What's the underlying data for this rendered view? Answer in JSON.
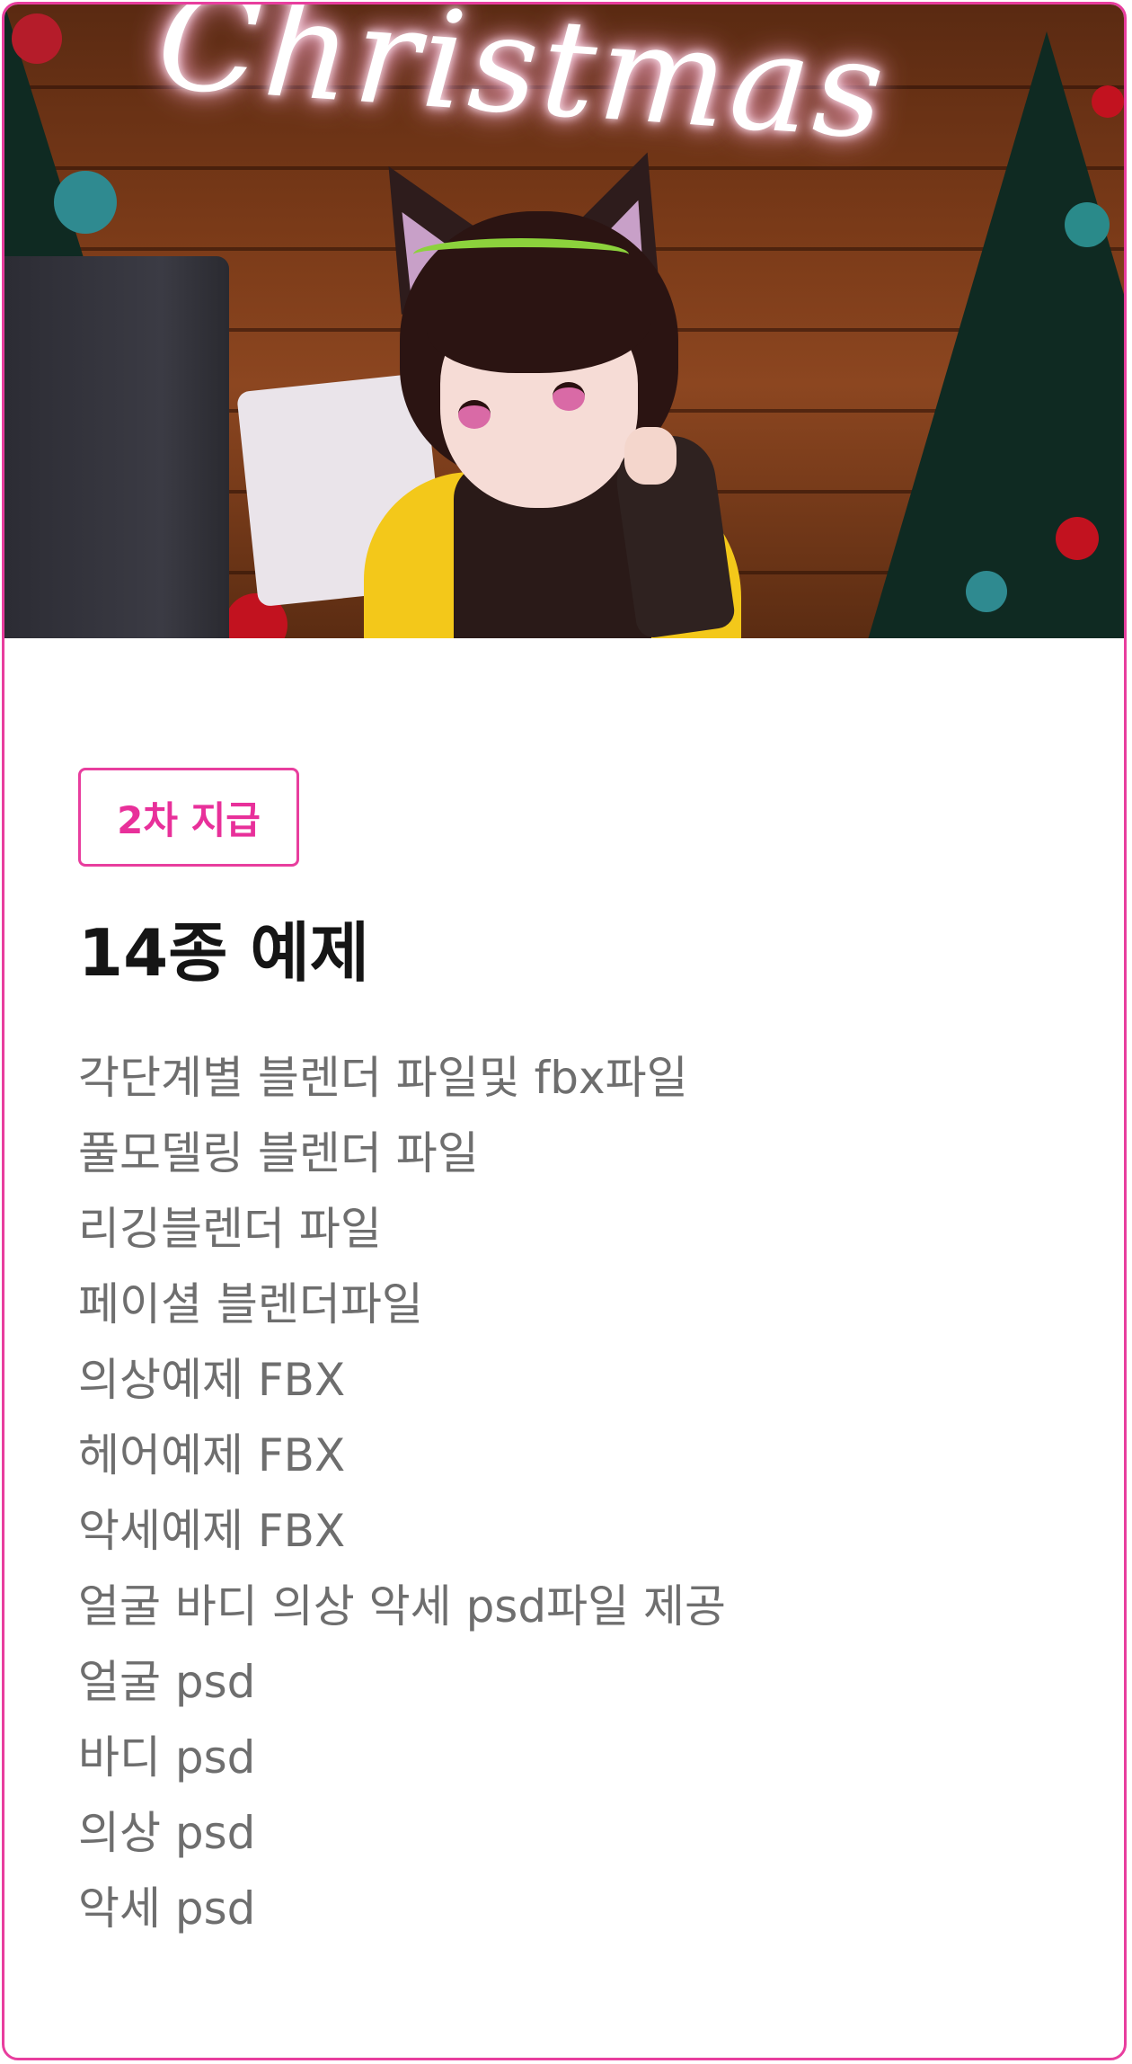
{
  "hero_image": {
    "neon_text": "Christmas"
  },
  "badge": "2차 지급",
  "title": "14종 예제",
  "items": [
    "각단계별 블렌더 파일및 fbx파일",
    "풀모델링 블렌더 파일",
    "리깅블렌더 파일",
    "페이셜 블렌더파일",
    "의상예제 FBX",
    "헤어예제 FBX",
    "악세예제 FBX",
    "얼굴 바디 의상 악세 psd파일 제공",
    "얼굴 psd",
    "바디 psd",
    "의상 psd",
    "악세 psd"
  ],
  "colors": {
    "accent": "#e83e9e",
    "title": "#151515",
    "body_text": "#6e6e6e"
  }
}
